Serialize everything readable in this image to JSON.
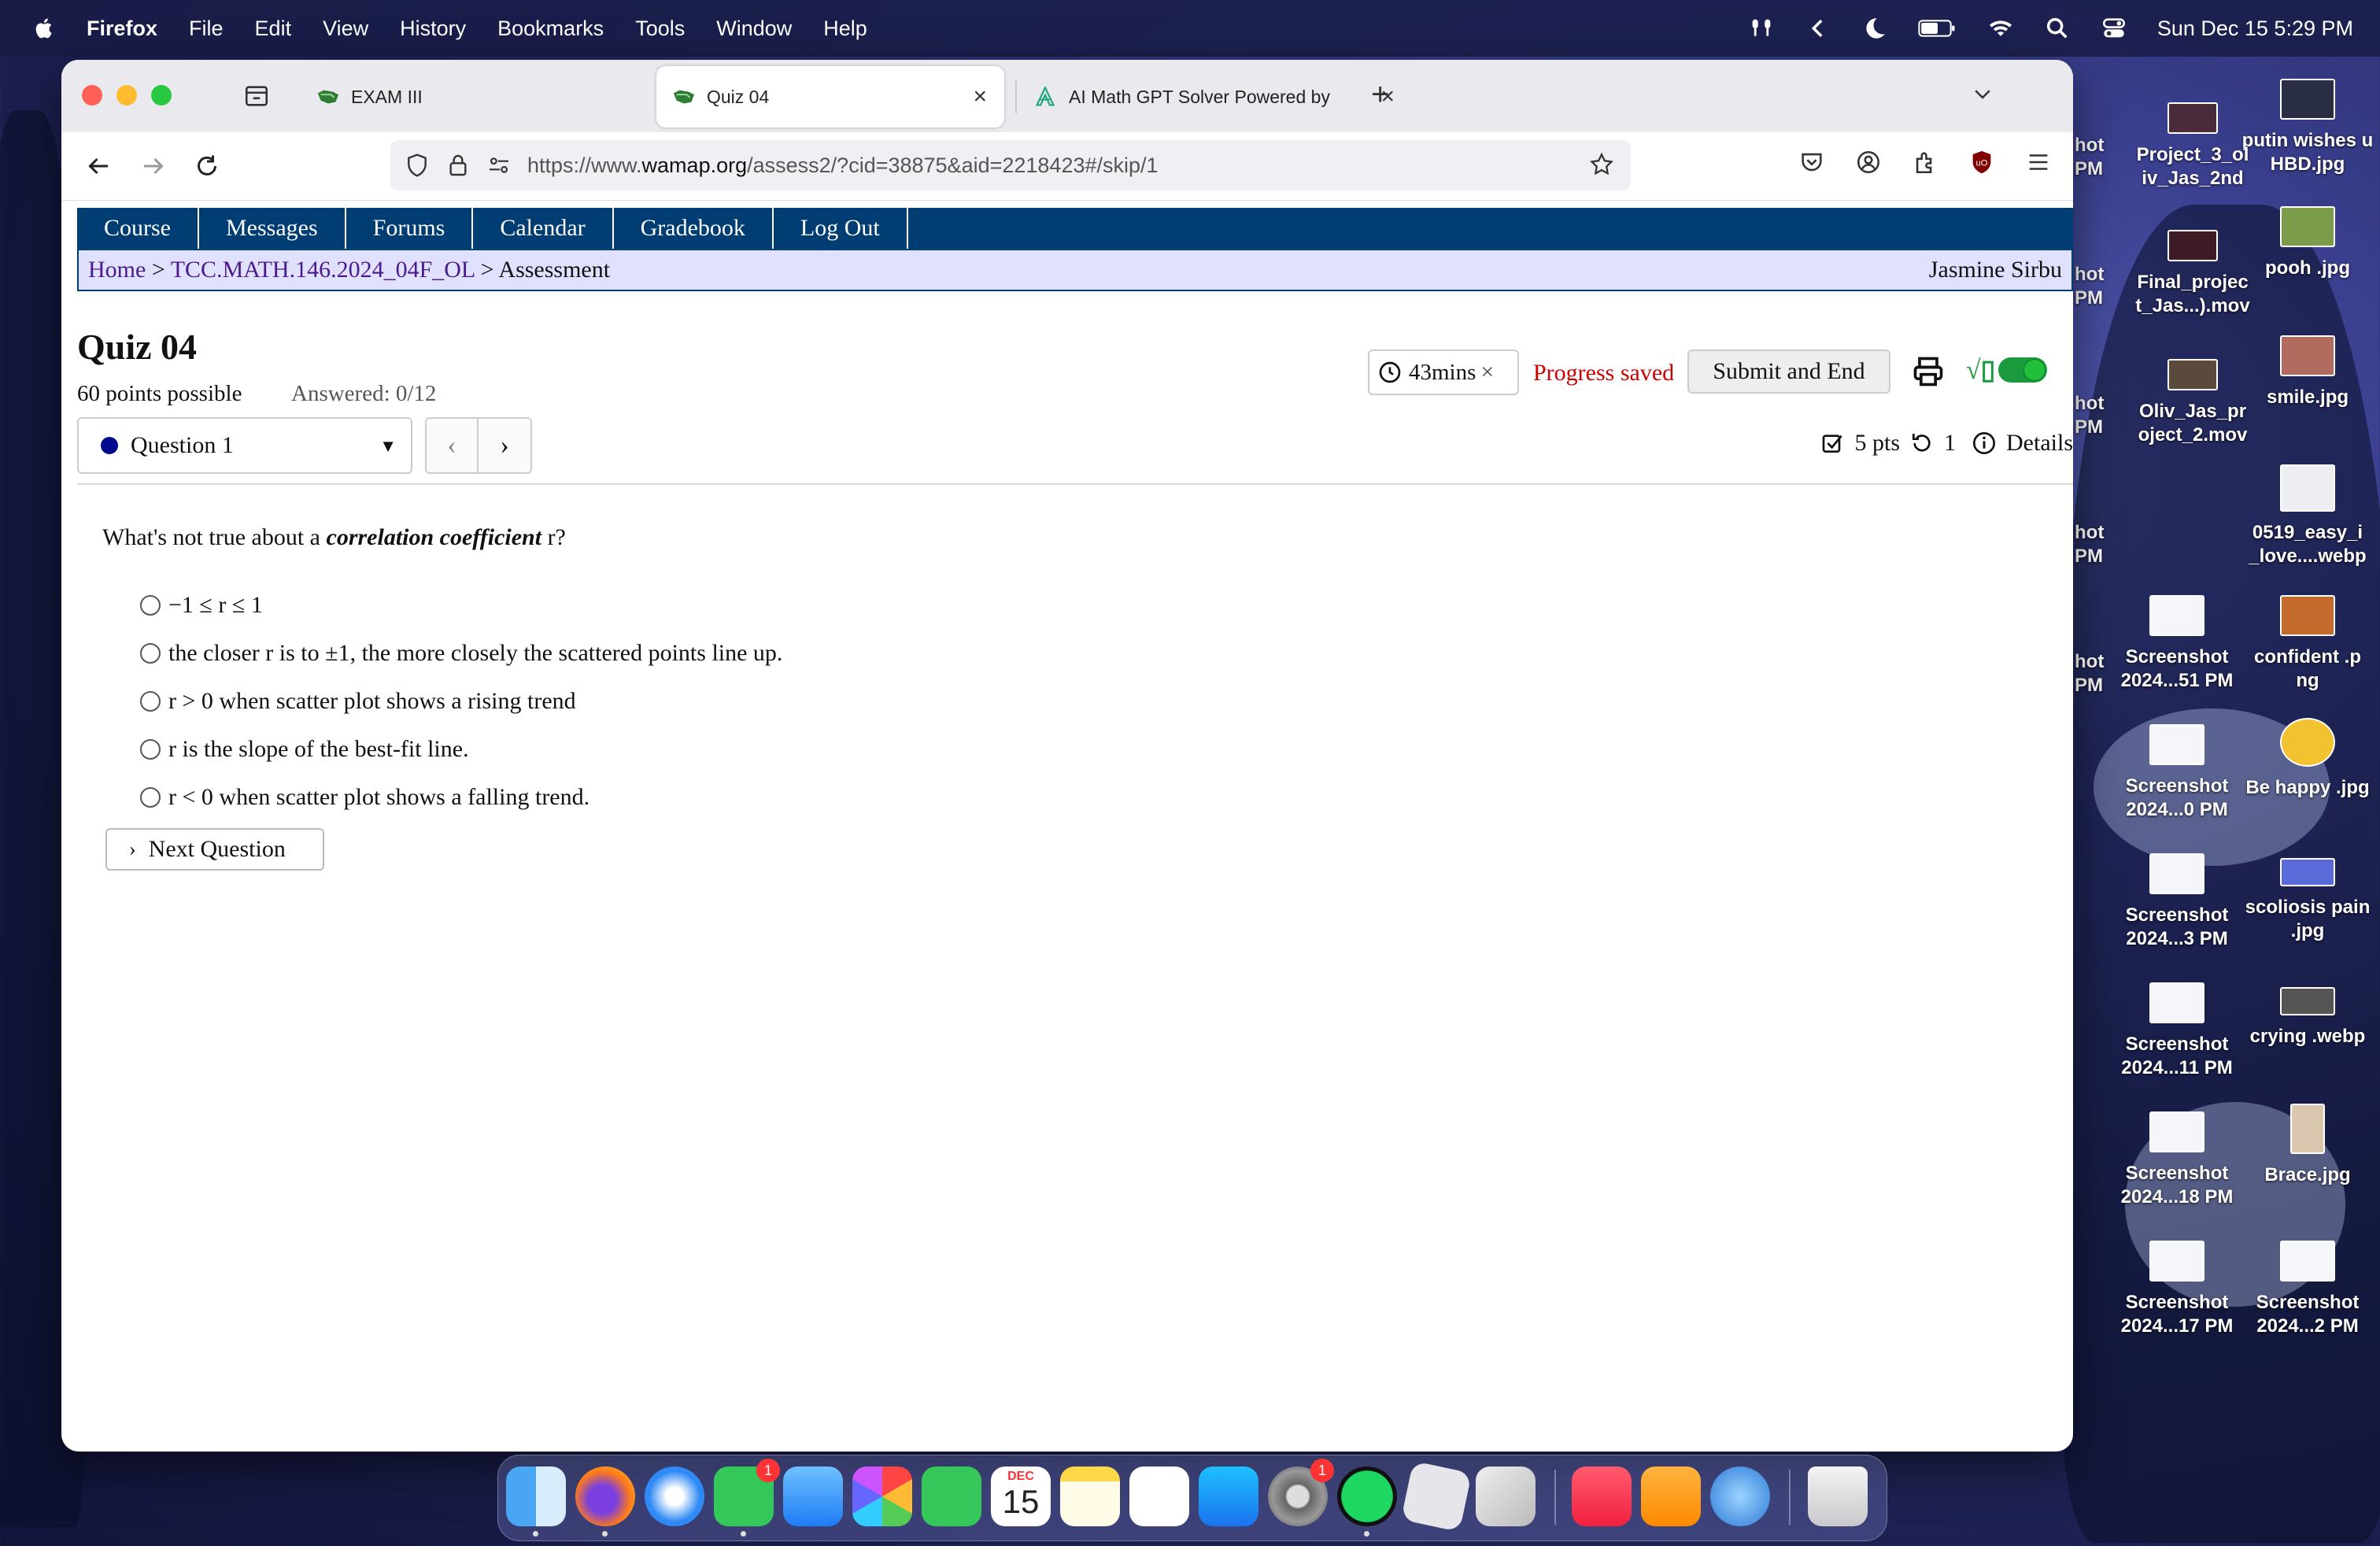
{
  "menubar": {
    "app": "Firefox",
    "items": [
      "File",
      "Edit",
      "View",
      "History",
      "Bookmarks",
      "Tools",
      "Window",
      "Help"
    ],
    "clock": "Sun Dec 15  5:29 PM"
  },
  "browser": {
    "tabs": [
      {
        "title": "EXAM III"
      },
      {
        "title": "Quiz 04"
      },
      {
        "title": "AI Math GPT Solver Powered by"
      }
    ],
    "url_prefix": "https://www.",
    "url_domain": "wamap.org",
    "url_path": "/assess2/?cid=38875&aid=2218423#/skip/1"
  },
  "site": {
    "nav": [
      "Course",
      "Messages",
      "Forums",
      "Calendar",
      "Gradebook",
      "Log Out"
    ],
    "breadcrumb": {
      "home": "Home",
      "course": "TCC.MATH.146.2024_04F_OL",
      "current": "Assessment",
      "sep": ">"
    },
    "user": "Jasmine Sirbu"
  },
  "quiz": {
    "title": "Quiz 04",
    "points": "60 points possible",
    "answered": "Answered: 0/12",
    "timer": "43mins",
    "saved": "Progress saved",
    "submit": "Submit and End",
    "question_select": "Question 1",
    "pts": "5 pts",
    "attempts": "1",
    "details": "Details",
    "question": {
      "pre": "What's not true about a ",
      "term": "correlation coefficient",
      "post": " r?"
    },
    "choices": [
      "−1 ≤ r ≤ 1",
      "the closer r is to ±1, the more closely the scattered points line up.",
      "r > 0 when scatter plot shows a rising trend",
      "r is the slope of the best-fit line.",
      "r < 0 when scatter plot shows a falling trend."
    ],
    "next": "Next Question"
  },
  "desktop": {
    "icons": [
      {
        "label": "putin wishes u HBD.jpg"
      },
      {
        "label": "Project_3_ol iv_Jas_2nd"
      },
      {
        "label": "pooh .jpg"
      },
      {
        "label": "Final_projec t_Jas...).mov"
      },
      {
        "label": "smile.jpg"
      },
      {
        "label": "Oliv_Jas_pr oject_2.mov"
      },
      {
        "label": "0519_easy_i _love....webp"
      },
      {
        "label": "Screenshot 2024...51 PM"
      },
      {
        "label": "confident .p ng"
      },
      {
        "label": "Screenshot 2024...0 PM"
      },
      {
        "label": "Be happy .jpg"
      },
      {
        "label": "Screenshot 2024...3 PM"
      },
      {
        "label": "scoliosis pain .jpg"
      },
      {
        "label": "Screenshot 2024...11 PM"
      },
      {
        "label": "crying .webp"
      },
      {
        "label": "Screenshot 2024...18 PM"
      },
      {
        "label": "Brace.jpg"
      },
      {
        "label": "Screenshot 2024...17 PM"
      },
      {
        "label": "Screenshot 2024...2 PM"
      }
    ],
    "edge_labels": [
      "hot PM",
      "hot PM",
      "hot PM",
      "hot PM",
      "hot PM"
    ]
  },
  "dock": {
    "messages_badge": "1",
    "settings_badge": "1",
    "calendar_month": "DEC",
    "calendar_day": "15"
  }
}
